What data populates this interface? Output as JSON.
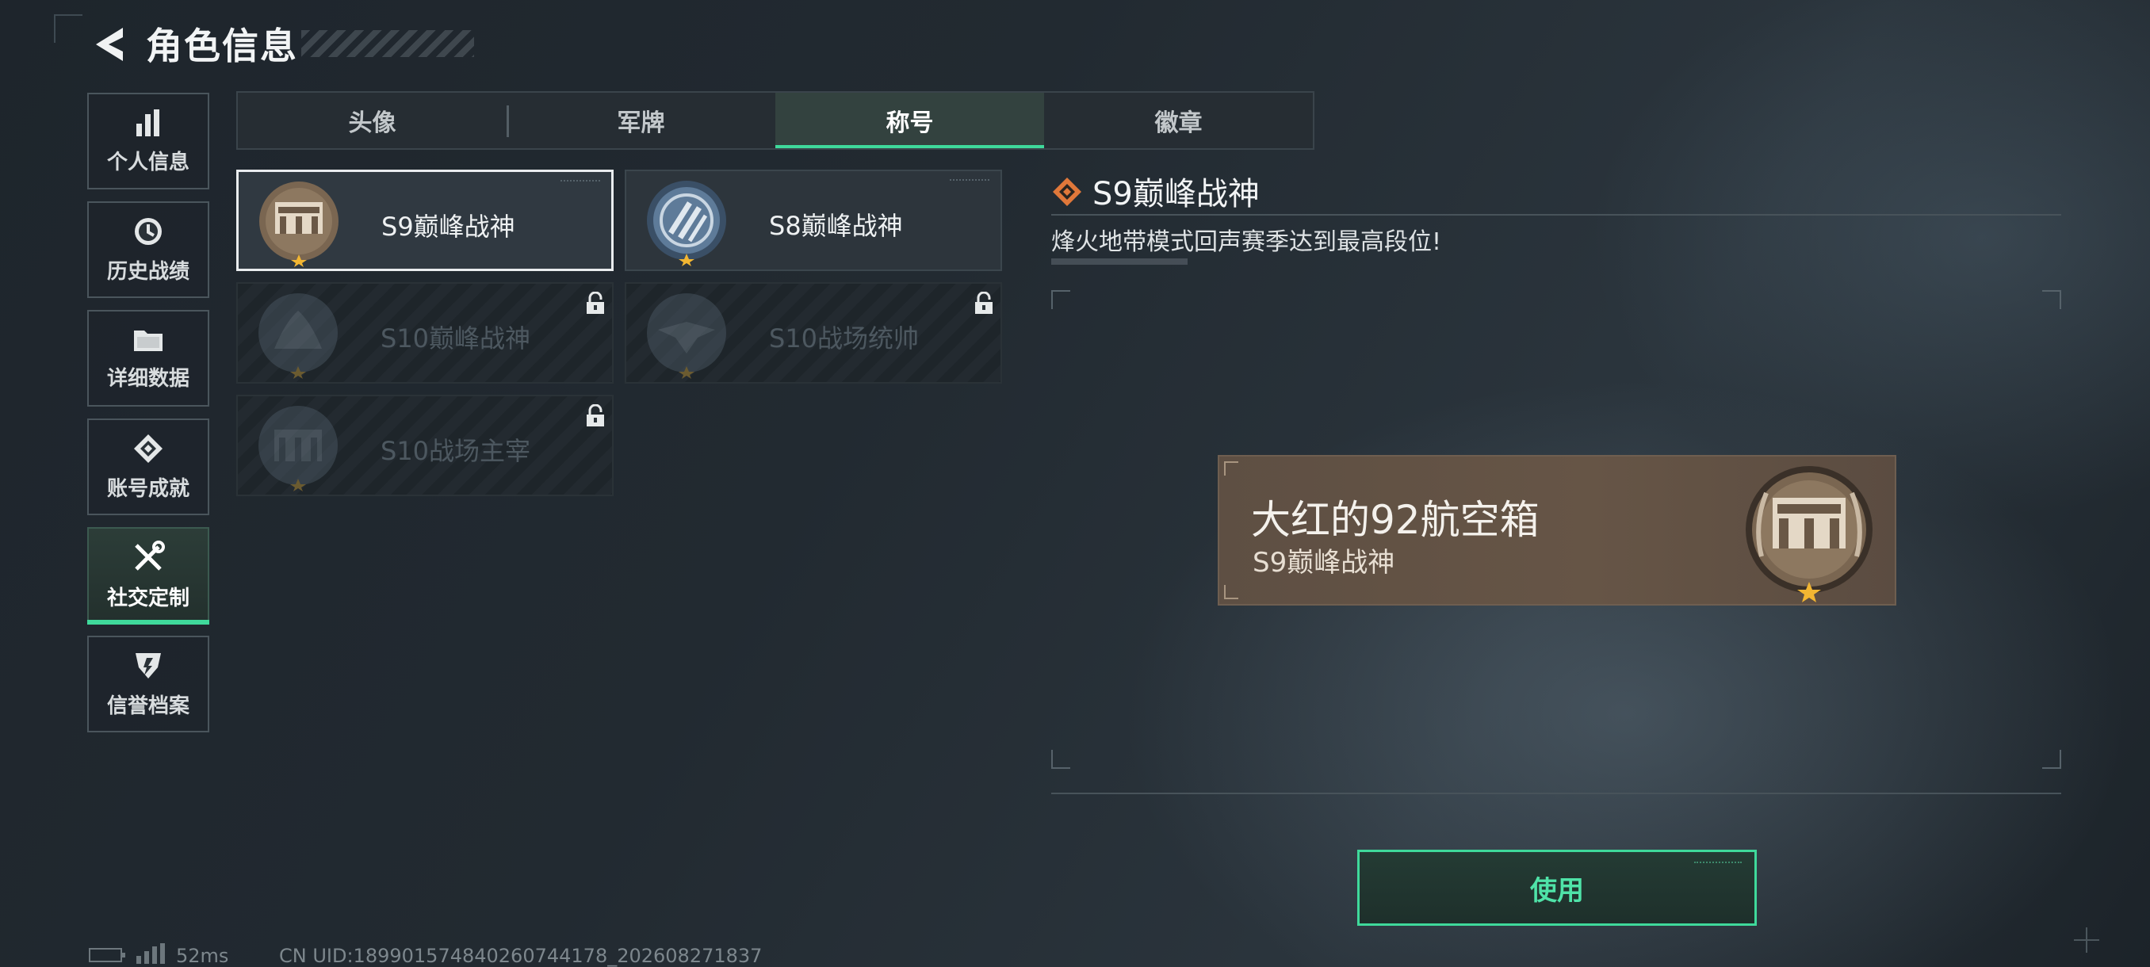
{
  "header": {
    "title": "角色信息"
  },
  "sidebar": {
    "items": [
      {
        "label": "个人信息",
        "icon": "bar-chart-icon"
      },
      {
        "label": "历史战绩",
        "icon": "clock-icon"
      },
      {
        "label": "详细数据",
        "icon": "folder-icon"
      },
      {
        "label": "账号成就",
        "icon": "achievement-icon"
      },
      {
        "label": "社交定制",
        "icon": "tools-icon",
        "active": true
      },
      {
        "label": "信誉档案",
        "icon": "shield-icon"
      }
    ]
  },
  "tabs": [
    {
      "label": "头像"
    },
    {
      "label": "军牌"
    },
    {
      "label": "称号",
      "active": true
    },
    {
      "label": "徽章"
    }
  ],
  "titles": [
    {
      "name": "S9巅峰战神",
      "selected": true,
      "locked": false
    },
    {
      "name": "S8巅峰战神",
      "selected": false,
      "locked": false
    },
    {
      "name": "S10巅峰战神",
      "selected": false,
      "locked": true
    },
    {
      "name": "S10战场统帅",
      "selected": false,
      "locked": true
    },
    {
      "name": "S10战场主宰",
      "selected": false,
      "locked": true
    }
  ],
  "detail": {
    "title": "S9巅峰战神",
    "description": "烽火地带模式回声赛季达到最高段位!"
  },
  "preview": {
    "player_name": "大红的92航空箱",
    "title": "S9巅峰战神"
  },
  "use_button": {
    "label": "使用"
  },
  "status": {
    "latency": "52ms",
    "uid": "CN UID:189901574840260744178_202608271837"
  },
  "colors": {
    "accent": "#3fd99b",
    "detail_icon": "#e0783a",
    "star": "#f2b632"
  }
}
